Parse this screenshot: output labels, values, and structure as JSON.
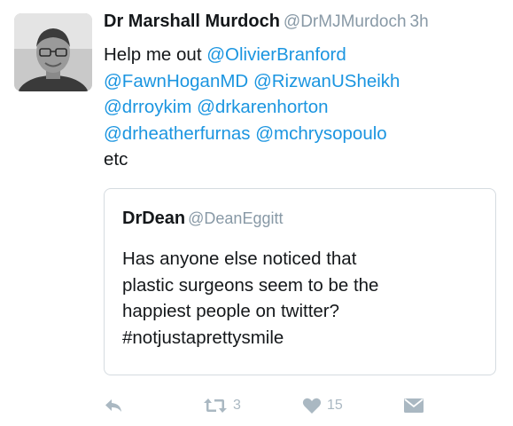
{
  "tweet": {
    "author_name": "Dr Marshall Murdoch",
    "author_handle": "@DrMJMurdoch",
    "time": "3h",
    "text_lines": [
      [
        "Help me out ",
        "@OlivierBranford"
      ],
      [
        "@FawnHoganMD",
        " ",
        "@RizwanUSheikh"
      ],
      [
        "@drroykim",
        " ",
        "@drkarenhorton"
      ],
      [
        "@drheatherfurnas",
        " ",
        "@mchrysopoulo"
      ],
      [
        "etc"
      ]
    ]
  },
  "quoted": {
    "author_name": "DrDean",
    "author_handle": "@DeanEggitt",
    "text_lines": [
      "Has anyone else noticed that",
      "plastic surgeons seem to be the",
      "happiest people on twitter?",
      "#notjustaprettysmile"
    ]
  },
  "actions": {
    "retweet_count": "3",
    "like_count": "15",
    "icons": [
      "reply-icon",
      "retweet-icon",
      "heart-icon",
      "envelope-icon"
    ]
  },
  "colors": {
    "link": "#1b95e0",
    "muted": "#8899a6",
    "icon": "#aab8c2",
    "border": "#d5dbe0"
  }
}
